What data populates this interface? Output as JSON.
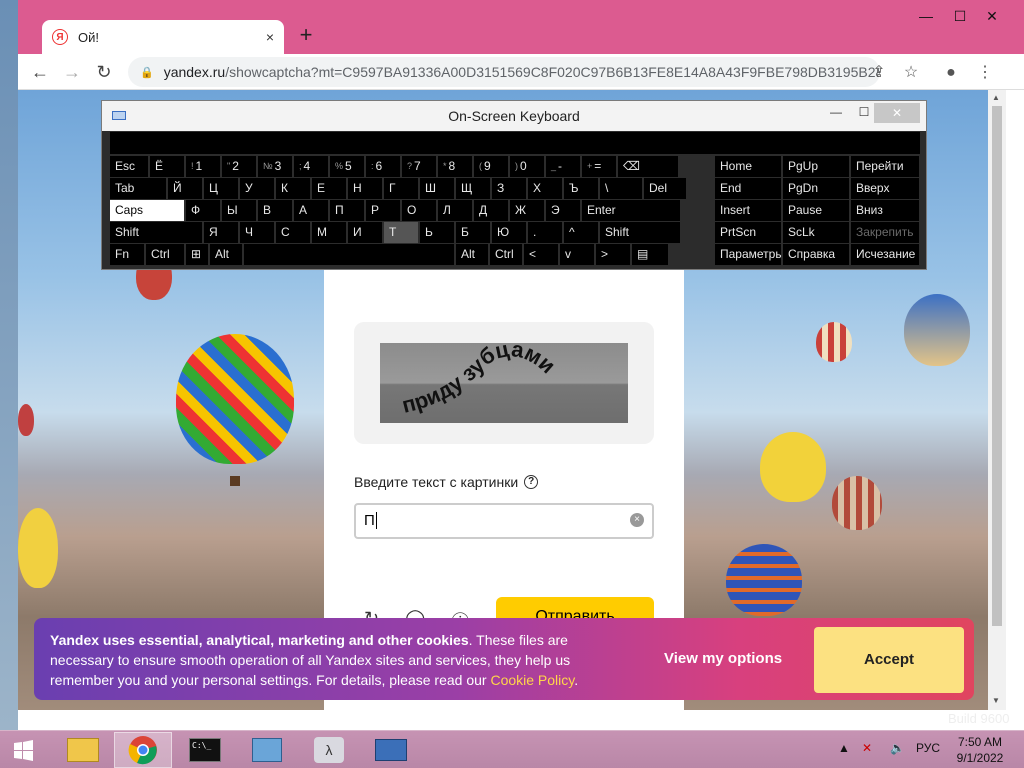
{
  "browser": {
    "tab_title": "Ой!",
    "tab_close": "×",
    "new_tab": "+",
    "url_host": "yandex.ru",
    "url_path": "/showcaptcha?mt=C9597BA91336A00D3151569C8F020C97B6B13FE8E14A8A43F9FBE798DB3195B2&r...",
    "window_controls": [
      "—",
      "☐",
      "✕"
    ]
  },
  "osk": {
    "title": "On-Screen Keyboard",
    "rows": [
      [
        "Esc",
        "Ё",
        "1",
        "2",
        "3",
        "4",
        "5",
        "6",
        "7",
        "8",
        "9",
        "0",
        "-",
        "=",
        "⌫"
      ],
      [
        "Tab",
        "Й",
        "Ц",
        "У",
        "К",
        "Е",
        "Н",
        "Г",
        "Ш",
        "Щ",
        "З",
        "Х",
        "Ъ",
        "\\",
        "Del"
      ],
      [
        "Caps",
        "Ф",
        "Ы",
        "В",
        "А",
        "П",
        "Р",
        "О",
        "Л",
        "Д",
        "Ж",
        "Э",
        "Enter"
      ],
      [
        "Shift",
        "Я",
        "Ч",
        "С",
        "М",
        "И",
        "Т",
        "Ь",
        "Б",
        "Ю",
        ".",
        "^",
        "Shift"
      ],
      [
        "Fn",
        "Ctrl",
        "⊞",
        "Alt",
        "",
        "Alt",
        "Ctrl",
        "<",
        "v",
        ">",
        "▤"
      ]
    ],
    "nav_keys": [
      [
        "Home",
        "PgUp"
      ],
      [
        "End",
        "PgDn"
      ],
      [
        "Insert",
        "Pause"
      ],
      [
        "PrtScn",
        "ScLk"
      ],
      [
        "Параметры",
        "Справка"
      ]
    ],
    "side_keys": [
      "Перейти",
      "Вверх",
      "Вниз",
      "Закрепить",
      "Исчезание"
    ]
  },
  "captcha": {
    "words": "приду зубцами",
    "prompt": "Введите текст с картинки",
    "input_value": "П",
    "submit_label": "Отправить"
  },
  "cookie": {
    "bold_text": "Yandex uses essential, analytical, marketing and other cookies",
    "text": ". These files are necessary to ensure smooth operation of all Yandex sites and services, they help us remember you and your personal settings. For details, please read our ",
    "link": "Cookie Policy",
    "end": ".",
    "view_options": "View my options",
    "accept": "Accept"
  },
  "taskbar": {
    "language": "РУС",
    "time": "7:50 AM",
    "date": "9/1/2022",
    "build": "Build 9600"
  }
}
